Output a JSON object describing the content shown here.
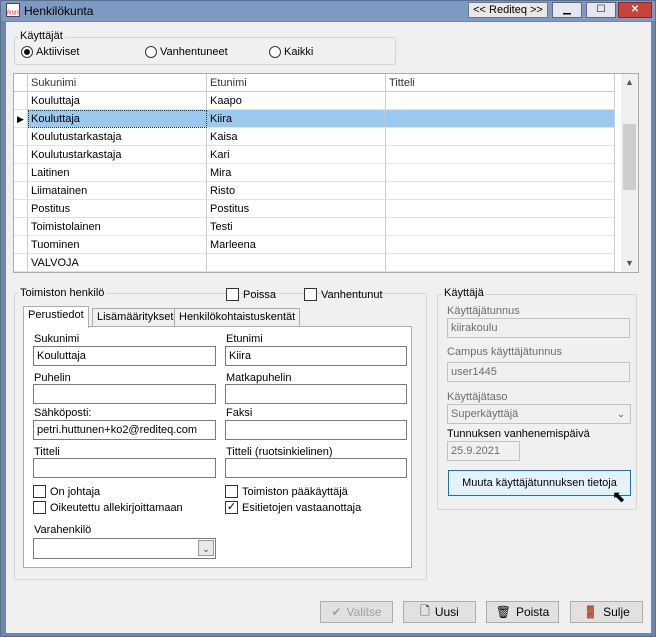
{
  "window": {
    "title": "Henkilökunta",
    "rediteq_button": "<< Rediteq >>",
    "app_icon_text": "RMS"
  },
  "users_group": {
    "legend": "Käyttäjät",
    "radios": [
      {
        "label": "Aktiiviset",
        "checked": true
      },
      {
        "label": "Vanhentuneet",
        "checked": false
      },
      {
        "label": "Kaikki",
        "checked": false
      }
    ]
  },
  "grid": {
    "columns": [
      "Sukunimi",
      "Etunimi",
      "Titteli"
    ],
    "rows": [
      [
        "Kouluttaja",
        "Kaapo",
        ""
      ],
      [
        "Kouluttaja",
        "Kiira",
        ""
      ],
      [
        "Koulutustarkastaja",
        "Kaisa",
        ""
      ],
      [
        "Koulutustarkastaja",
        "Kari",
        ""
      ],
      [
        "Laitinen",
        "Mira",
        ""
      ],
      [
        "Liimatainen",
        "Risto",
        ""
      ],
      [
        "Postitus",
        "Postitus",
        ""
      ],
      [
        "Toimistolainen",
        "Testi",
        ""
      ],
      [
        "Tuominen",
        "Marleena",
        ""
      ],
      [
        "VALVOJA",
        "",
        ""
      ]
    ],
    "selected_index": 1
  },
  "office_group": {
    "legend": "Toimiston henkilö",
    "absent_label": "Poissa",
    "expired_label": "Vanhentunut",
    "tabs": [
      "Perustiedot",
      "Lisämääritykset",
      "Henkilökohtaistuskentät"
    ],
    "fields": {
      "surname_label": "Sukunimi",
      "surname_value": "Kouluttaja",
      "firstname_label": "Etunimi",
      "firstname_value": "Kiira",
      "phone_label": "Puhelin",
      "phone_value": "",
      "mobile_label": "Matkapuhelin",
      "mobile_value": "",
      "email_label": "Sähköposti:",
      "email_value": "petri.huttunen+ko2@rediteq.com",
      "fax_label": "Faksi",
      "fax_value": "",
      "title_label": "Titteli",
      "title_value": "",
      "title_sv_label": "Titteli (ruotsinkielinen)",
      "title_sv_value": "",
      "is_manager_label": "On johtaja",
      "can_sign_label": "Oikeutettu allekirjoittamaan",
      "office_admin_label": "Toimiston pääkäyttäjä",
      "presenter_label": "Esitietojen vastaanottaja",
      "presenter_checked": true,
      "deputy_label": "Varahenkilö",
      "deputy_value": ""
    }
  },
  "user_group": {
    "legend": "Käyttäjä",
    "username_label": "Käyttäjätunnus",
    "username_value": "kiirakoulu",
    "campus_label": "Campus käyttäjätunnus",
    "campus_value": "user1445",
    "level_label": "Käyttäjätaso",
    "level_value": "Superkäyttäjä",
    "expiry_label": "Tunnuksen vanhenemispäivä",
    "expiry_value": "25.9.2021",
    "change_button": "Muuta käyttäjätunnuksen tietoja"
  },
  "buttons": {
    "select": "Valitse",
    "new": "Uusi",
    "delete": "Poista",
    "close": "Sulje"
  }
}
